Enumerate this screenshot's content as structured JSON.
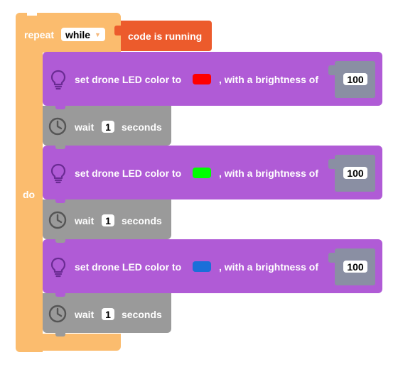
{
  "repeat": {
    "label": "repeat",
    "mode": "while",
    "condition": "code is running",
    "do_label": "do",
    "color": "#fbbc6e",
    "condition_color": "#ec5b2c"
  },
  "led_blocks": [
    {
      "label": "set drone LED color to",
      "swatch_color": "#ff0000",
      "brightness_label": ", with a brightness of",
      "brightness": "100"
    },
    {
      "label": "set drone LED color to",
      "swatch_color": "#00ff00",
      "brightness_label": ", with a brightness of",
      "brightness": "100"
    },
    {
      "label": "set drone LED color to",
      "swatch_color": "#1a6fd9",
      "brightness_label": ", with a brightness of",
      "brightness": "100"
    }
  ],
  "wait_blocks": [
    {
      "label": "wait",
      "value": "1",
      "unit": "seconds"
    },
    {
      "label": "wait",
      "value": "1",
      "unit": "seconds"
    },
    {
      "label": "wait",
      "value": "1",
      "unit": "seconds"
    }
  ],
  "icons": {
    "led": "lightbulb-icon",
    "wait": "clock-icon",
    "dropdown": "caret-down-icon"
  },
  "colors": {
    "led_block": "#b05bd6",
    "wait_block": "#9a9a9a",
    "value_slot": "#8a8fa3"
  }
}
